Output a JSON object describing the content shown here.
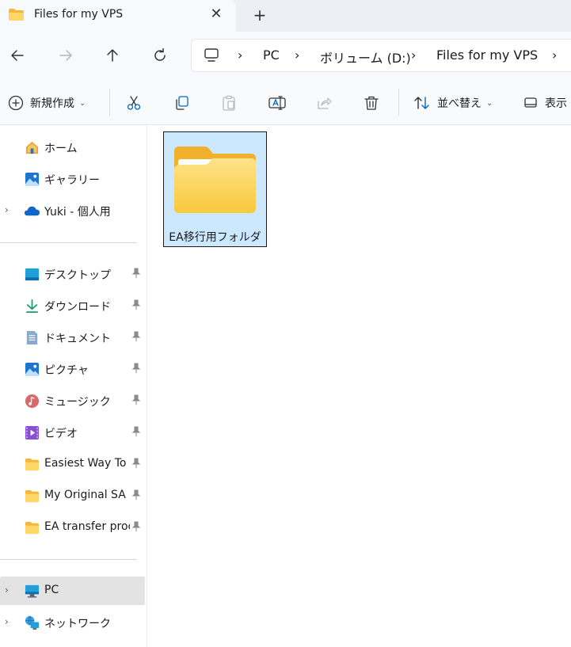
{
  "tab": {
    "title": "Files for my VPS",
    "close": "✕",
    "new_tab": "+"
  },
  "address": {
    "items": [
      "PC",
      "ボリューム (D:)",
      "Files for my VPS"
    ],
    "sep": "›"
  },
  "toolbar": {
    "new_label": "新規作成",
    "sort_label": "並べ替え",
    "view_label": "表示",
    "chevron": "⌄"
  },
  "sidebar": {
    "items": [
      {
        "label": "ホーム",
        "icon": "home-icon"
      },
      {
        "label": "ギャラリー",
        "icon": "gallery-icon"
      },
      {
        "label": "Yuki - 個人用",
        "icon": "onedrive-cloud-icon",
        "expand": "›"
      },
      {
        "label": "デスクトップ",
        "icon": "desktop-icon"
      },
      {
        "label": "ダウンロード",
        "icon": "download-icon"
      },
      {
        "label": "ドキュメント",
        "icon": "document-icon"
      },
      {
        "label": "ピクチャ",
        "icon": "pictures-icon"
      },
      {
        "label": "ミュージック",
        "icon": "music-icon"
      },
      {
        "label": "ビデオ",
        "icon": "video-icon"
      },
      {
        "label": "Easiest Way To T",
        "icon": "folder-icon"
      },
      {
        "label": "My Original SA (",
        "icon": "folder-icon"
      },
      {
        "label": "EA transfer proc",
        "icon": "folder-icon"
      },
      {
        "label": "PC",
        "icon": "pc-icon",
        "expand": "›"
      },
      {
        "label": "ネットワーク",
        "icon": "network-icon",
        "expand": "›"
      }
    ]
  },
  "content": {
    "folder_name": "EA移行用フォルダ"
  },
  "colors": {
    "selection": "#cce8ff",
    "folder_yellow": "#f8c93d",
    "accent": "#0067c0"
  }
}
